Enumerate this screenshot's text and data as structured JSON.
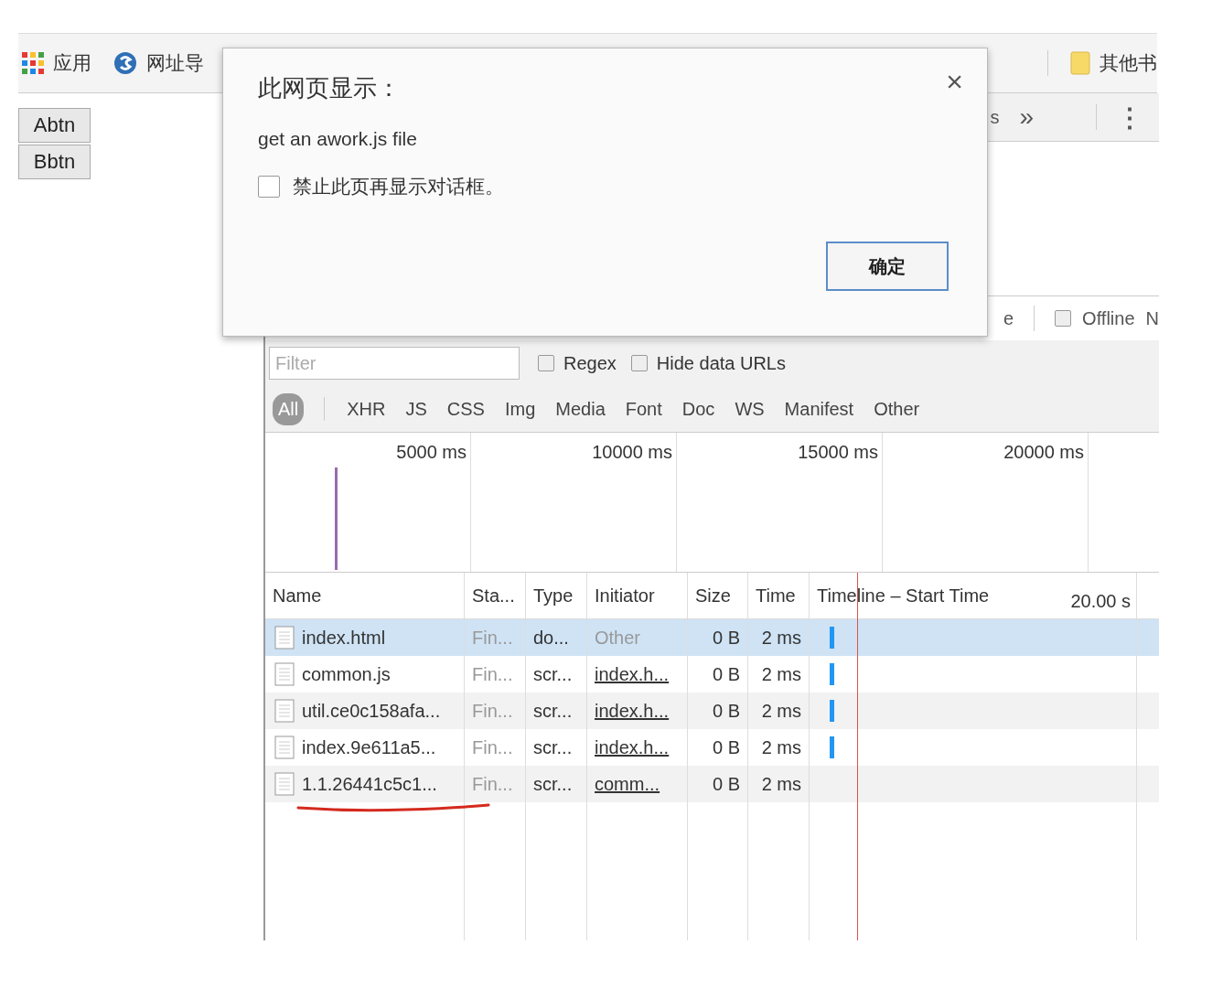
{
  "bookmarks": [
    {
      "label": "应用",
      "kind": "apps"
    },
    {
      "label": "网址导",
      "kind": "globe"
    },
    {
      "label": "其他书",
      "kind": "folder"
    }
  ],
  "page_buttons": [
    "Abtn",
    "Bbtn"
  ],
  "devtools": {
    "toolbar": {
      "tab_fragment": "s",
      "more": "»",
      "menu": "⋮"
    },
    "throttle": {
      "fragment": "e",
      "offline": {
        "label": "Offline",
        "checked": false
      },
      "next_fragment": "N"
    },
    "filter": {
      "placeholder": "Filter",
      "regex": {
        "label": "Regex",
        "checked": false
      },
      "hide_data_urls": {
        "label": "Hide data URLs",
        "checked": false
      }
    },
    "type_filters": [
      {
        "label": "All",
        "selected": true
      },
      {
        "label": "XHR",
        "selected": false
      },
      {
        "label": "JS",
        "selected": false
      },
      {
        "label": "CSS",
        "selected": false
      },
      {
        "label": "Img",
        "selected": false
      },
      {
        "label": "Media",
        "selected": false
      },
      {
        "label": "Font",
        "selected": false
      },
      {
        "label": "Doc",
        "selected": false
      },
      {
        "label": "WS",
        "selected": false
      },
      {
        "label": "Manifest",
        "selected": false
      },
      {
        "label": "Other",
        "selected": false
      }
    ],
    "overview_ticks": [
      "5000 ms",
      "10000 ms",
      "15000 ms",
      "20000 ms"
    ],
    "table": {
      "columns": [
        "Name",
        "Sta...",
        "Type",
        "Initiator",
        "Size",
        "Time",
        "Timeline – Start Time"
      ],
      "timeline_end": "20.00 s",
      "rows": [
        {
          "name": "index.html",
          "status": "Fin...",
          "type": "do...",
          "initiator": "Other",
          "initiator_link": false,
          "size": "0 B",
          "time": "2 ms",
          "has_bar": true,
          "selected": true,
          "underlined": false
        },
        {
          "name": "common.js",
          "status": "Fin...",
          "type": "scr...",
          "initiator": "index.h...",
          "initiator_link": true,
          "size": "0 B",
          "time": "2 ms",
          "has_bar": true,
          "selected": false,
          "underlined": false
        },
        {
          "name": "util.ce0c158afa...",
          "status": "Fin...",
          "type": "scr...",
          "initiator": "index.h...",
          "initiator_link": true,
          "size": "0 B",
          "time": "2 ms",
          "has_bar": true,
          "selected": false,
          "underlined": false
        },
        {
          "name": "index.9e611a5...",
          "status": "Fin...",
          "type": "scr...",
          "initiator": "index.h...",
          "initiator_link": true,
          "size": "0 B",
          "time": "2 ms",
          "has_bar": true,
          "selected": false,
          "underlined": false
        },
        {
          "name": "1.1.26441c5c1...",
          "status": "Fin...",
          "type": "scr...",
          "initiator": "comm...",
          "initiator_link": true,
          "size": "0 B",
          "time": "2 ms",
          "has_bar": false,
          "selected": false,
          "underlined": true
        }
      ]
    }
  },
  "dialog": {
    "title": "此网页显示：",
    "close": "×",
    "message": "get an awork.js file",
    "suppress": {
      "label": "禁止此页再显示对话框。",
      "checked": false
    },
    "ok_button": "确定"
  }
}
